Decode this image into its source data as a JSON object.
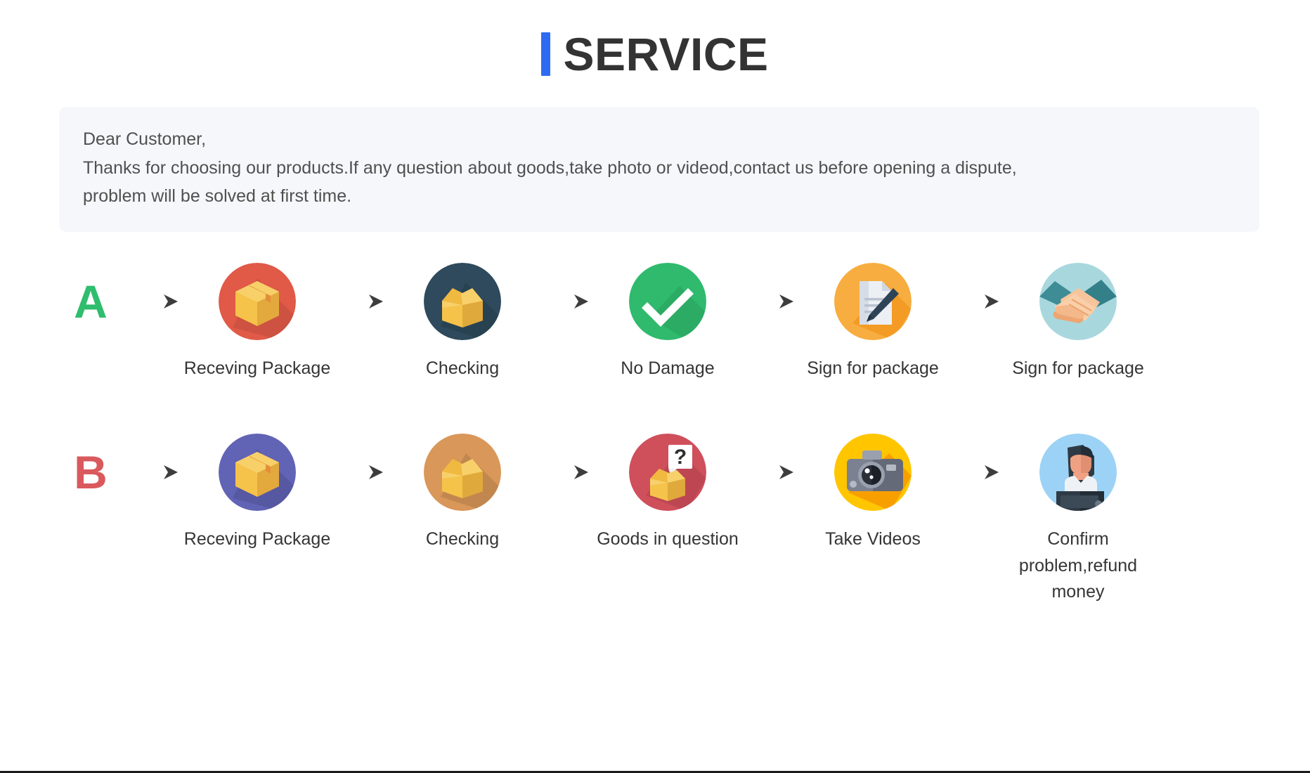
{
  "header": {
    "accent_color": "#2f6bf2",
    "title": "SERVICE"
  },
  "notice": {
    "line1": "Dear Customer,",
    "line2": "Thanks for choosing our products.If any question about goods,take photo or videod,contact us before opening a dispute,",
    "line3": "problem will be solved at first time.",
    "background_color": "#f5f7fa"
  },
  "flows": [
    {
      "letter": "A",
      "letter_color": "#2fbd6e",
      "steps": [
        {
          "label": "Receving Package",
          "icon": "package-box-icon",
          "circle_color": "#e05a47"
        },
        {
          "label": "Checking",
          "icon": "open-box-icon",
          "circle_color": "#2e4a5c"
        },
        {
          "label": "No Damage",
          "icon": "check-mark-icon",
          "circle_color": "#2fba6d"
        },
        {
          "label": "Sign for package",
          "icon": "sign-document-icon",
          "circle_color": "#f7ad3f"
        },
        {
          "label": "Sign for package",
          "icon": "handshake-icon",
          "circle_color": "#a8d8de"
        }
      ]
    },
    {
      "letter": "B",
      "letter_color": "#d9595d",
      "steps": [
        {
          "label": "Receving Package",
          "icon": "package-box-icon",
          "circle_color": "#6163b5"
        },
        {
          "label": "Checking",
          "icon": "open-box-icon",
          "circle_color": "#d99759"
        },
        {
          "label": "Goods in question",
          "icon": "question-box-icon",
          "circle_color": "#cf4f5b"
        },
        {
          "label": "Take Videos",
          "icon": "camera-icon",
          "circle_color": "#ffc600"
        },
        {
          "label": "Confirm problem,refund money",
          "icon": "support-person-icon",
          "circle_color": "#9cd2f5"
        }
      ]
    }
  ],
  "arrow": {
    "name": "arrow-right-icon",
    "color": "#4a4a4a"
  }
}
